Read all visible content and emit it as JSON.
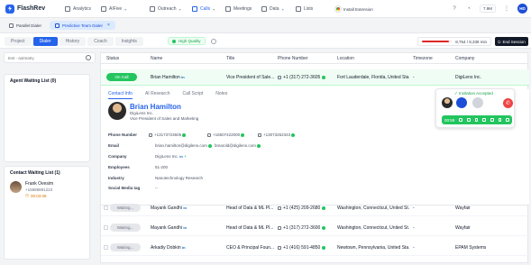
{
  "app": {
    "name": "FlashRev"
  },
  "nav": [
    {
      "label": "Analytics",
      "caret": false
    },
    {
      "label": "AIFive",
      "caret": true
    },
    {
      "label": "Outreach",
      "caret": true
    },
    {
      "label": "Calls",
      "caret": true
    },
    {
      "label": "Meetings",
      "caret": false
    },
    {
      "label": "Data",
      "caret": true
    },
    {
      "label": "Lists",
      "caret": false
    }
  ],
  "install_label": "Install Extension",
  "topright": {
    "badge": "7.9M",
    "avatar": "HD"
  },
  "subtabs": [
    "Parallel Dialer",
    "Predictive Team Dialer"
  ],
  "modes": [
    "Project",
    "Dialer",
    "History",
    "Coach",
    "Insights"
  ],
  "quality": {
    "label": "High Quality"
  },
  "progress": {
    "text": "8,754 / 8,338 min",
    "fraction": 0.9
  },
  "end_session": "End Session",
  "search": {
    "placeholder": "test - autmatry"
  },
  "agent_waiting": {
    "title": "Agent Waiting List (0)"
  },
  "contact_waiting": {
    "title": "Contact Waiting List (1)",
    "items": [
      {
        "name": "Frank Ovesim",
        "phone": "+15888881223",
        "time": "00:03:08"
      }
    ]
  },
  "table": {
    "headers": [
      "Status",
      "Name",
      "Title",
      "Phone Number",
      "Location",
      "Timezone",
      "Company"
    ],
    "rows": [
      {
        "status": "On Call",
        "name": "Brian Hamilton",
        "title": "Vice President of Sale...",
        "phone": "+1 (317) 272-3605",
        "location": "Fort Lauderdale, Florida, United Sta...",
        "timezone": "-",
        "company": "DigiLens Inc."
      },
      {
        "status": "Waiting...",
        "name": "Mayank Gandhi",
        "title": "Head of Data & ML Pl...",
        "phone": "+1 (425) 209-2680",
        "location": "Washington, Connecticut, United St...",
        "timezone": "-",
        "company": "Wayfair"
      },
      {
        "status": "Waiting...",
        "name": "Mayank Gandhi",
        "title": "Head of Data & ML Pl...",
        "phone": "+1 (317) 272-3600",
        "location": "Washington, Connecticut, United St...",
        "timezone": "-",
        "company": "Wayfair"
      },
      {
        "status": "Waiting...",
        "name": "Arkadiy Dobkin",
        "title": "CEO & Principal Foun...",
        "phone": "+1 (416) 591-4850",
        "location": "Newtown, Pennsylvania, United Sta...",
        "timezone": "-",
        "company": "EPAM Systems"
      }
    ]
  },
  "detail": {
    "tabs": [
      "Contact Info",
      "AI Research",
      "Call Script",
      "Notes"
    ],
    "name": "Brian Hamilton",
    "company": "DigiLens Inc.",
    "role": "Vice President of Sales and Marketing",
    "fields": {
      "phone_label": "Phone Number",
      "phones": [
        "+13173723605",
        "+16507422000",
        "+13073252343"
      ],
      "email_label": "Email",
      "emails": [
        "brian.hamilton@digilens.com",
        "bmarold@digilens.com"
      ],
      "company_label": "Company",
      "company_value": "DigiLens Inc.",
      "employees_label": "Employees",
      "employees_value": "51-200",
      "industry_label": "Industry",
      "industry_value": "Nanotechnology Research",
      "social_label": "Social Media tag",
      "social_value": "--"
    }
  },
  "call_widget": {
    "status": "Invitation Accepted",
    "timer": "00:59"
  }
}
